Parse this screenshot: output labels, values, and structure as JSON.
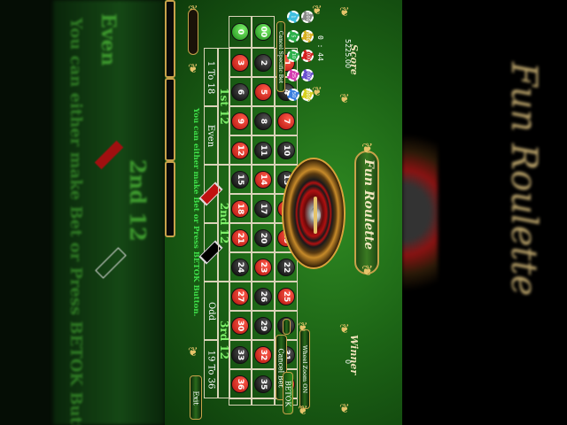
{
  "app": {
    "title": "Fun Roulette"
  },
  "score": {
    "label": "Score",
    "value": "5225.00"
  },
  "winner": {
    "label": "Winner",
    "value": "0"
  },
  "timer": {
    "value": "0 : 44"
  },
  "buttons": {
    "cancel_specific_bet": "Cancel Specific Bet",
    "cancel_bet": "Cancel Bet",
    "betok": "BETOK",
    "wheel_zoom": "Wheel Zoom  ON",
    "exit": "Exit"
  },
  "instruction": "You can either make Bet or Press BETOK Button.",
  "zero_numbers": [
    "0",
    "00"
  ],
  "grid_rows": [
    [
      {
        "n": "3",
        "c": "red"
      },
      {
        "n": "2",
        "c": "black"
      },
      {
        "n": "1",
        "c": "red"
      }
    ],
    [
      {
        "n": "6",
        "c": "black"
      },
      {
        "n": "5",
        "c": "red"
      },
      {
        "n": "4",
        "c": "black"
      }
    ],
    [
      {
        "n": "9",
        "c": "red"
      },
      {
        "n": "8",
        "c": "black"
      },
      {
        "n": "7",
        "c": "red"
      }
    ],
    [
      {
        "n": "12",
        "c": "red"
      },
      {
        "n": "11",
        "c": "black"
      },
      {
        "n": "10",
        "c": "black"
      }
    ],
    [
      {
        "n": "15",
        "c": "black"
      },
      {
        "n": "14",
        "c": "red"
      },
      {
        "n": "13",
        "c": "black"
      }
    ],
    [
      {
        "n": "18",
        "c": "red"
      },
      {
        "n": "17",
        "c": "black"
      },
      {
        "n": "16",
        "c": "red"
      }
    ],
    [
      {
        "n": "21",
        "c": "red"
      },
      {
        "n": "20",
        "c": "black"
      },
      {
        "n": "19",
        "c": "red"
      }
    ],
    [
      {
        "n": "24",
        "c": "black"
      },
      {
        "n": "23",
        "c": "red"
      },
      {
        "n": "22",
        "c": "black"
      }
    ],
    [
      {
        "n": "27",
        "c": "red"
      },
      {
        "n": "26",
        "c": "black"
      },
      {
        "n": "25",
        "c": "red"
      }
    ],
    [
      {
        "n": "30",
        "c": "red"
      },
      {
        "n": "29",
        "c": "black"
      },
      {
        "n": "28",
        "c": "black"
      }
    ],
    [
      {
        "n": "33",
        "c": "black"
      },
      {
        "n": "32",
        "c": "red"
      },
      {
        "n": "31",
        "c": "black"
      }
    ],
    [
      {
        "n": "36",
        "c": "red"
      },
      {
        "n": "35",
        "c": "black"
      },
      {
        "n": "34",
        "c": "red"
      }
    ]
  ],
  "column_bets": [
    "2 to 1",
    "2 to 1",
    "2 to 1"
  ],
  "dozens": [
    "1st 12",
    "2nd 12",
    "3rd 12"
  ],
  "outside_bets": [
    "1 To 18",
    "Even",
    "Odd",
    "19 To 36"
  ],
  "chips": [
    {
      "label": "1",
      "color": "#3fbfe0"
    },
    {
      "label": "5",
      "color": "#2bb04a"
    },
    {
      "label": "10",
      "color": "#2bb04a"
    },
    {
      "label": "25",
      "color": "#d63ab0"
    },
    {
      "label": "50",
      "color": "#3a7fe0"
    },
    {
      "label": "100",
      "color": "#8a8a8a"
    },
    {
      "label": "500",
      "color": "#d8b020"
    },
    {
      "label": "1000",
      "color": "#d62020"
    },
    {
      "label": "5000",
      "color": "#6a4fd0"
    },
    {
      "label": "10000",
      "color": "#d8d020"
    }
  ],
  "side_text": {
    "left_lines": [
      "Even",
      "2nd 12",
      "You can either make Bet or Press BETOK Butt"
    ],
    "right_title": "Fun Roulette"
  }
}
